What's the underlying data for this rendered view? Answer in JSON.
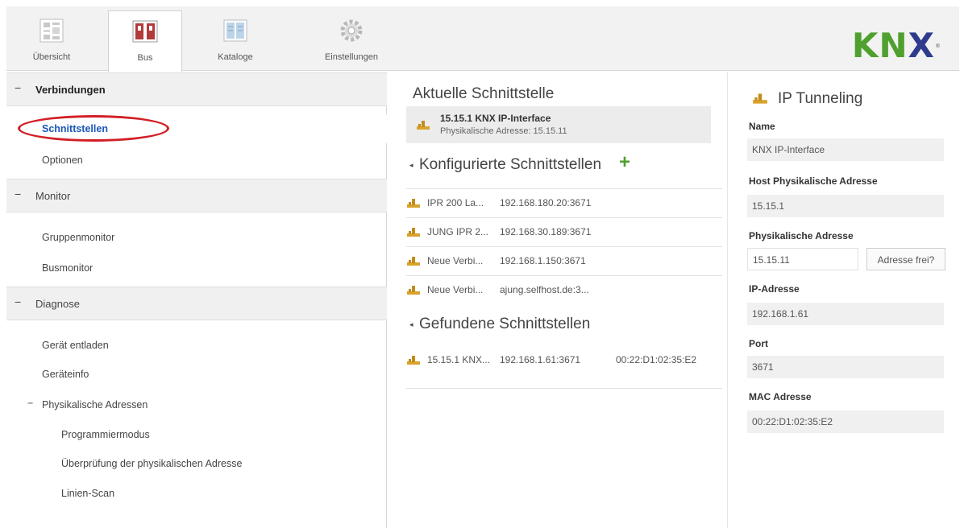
{
  "ribbon": {
    "tabs": [
      {
        "label": "Übersicht",
        "icon": "overview-icon"
      },
      {
        "label": "Bus",
        "icon": "bus-icon"
      },
      {
        "label": "Kataloge",
        "icon": "catalog-icon"
      },
      {
        "label": "Einstellungen",
        "icon": "gear-icon"
      }
    ],
    "active_tab": "Bus",
    "logo": {
      "k": "K",
      "n": "N",
      "x": "X",
      "reg": "®"
    }
  },
  "sidebar": {
    "sections": [
      {
        "label": "Verbindungen",
        "toggle": "−"
      },
      {
        "label": "Monitor",
        "toggle": "−"
      },
      {
        "label": "Diagnose",
        "toggle": "−"
      }
    ],
    "verbindungen_items": [
      "Schnittstellen",
      "Optionen"
    ],
    "monitor_items": [
      "Gruppenmonitor",
      "Busmonitor"
    ],
    "diagnose_items": [
      "Gerät entladen",
      "Geräteinfo"
    ],
    "physical_group": {
      "toggle": "−",
      "label": "Physikalische Adressen"
    },
    "physical_items": [
      "Programmiermodus",
      "Überprüfung der physikalischen Adresse",
      "Linien-Scan"
    ],
    "selected": "Schnittstellen"
  },
  "middle": {
    "current_heading": "Aktuelle Schnittstelle",
    "current": {
      "name": "15.15.1 KNX IP-Interface",
      "address": "Physikalische Adresse: 15.15.11"
    },
    "configured_heading": "Konfigurierte Schnittstellen",
    "configured_add": "+",
    "configured": [
      {
        "name": "IPR 200 La...",
        "address": "192.168.180.20:3671"
      },
      {
        "name": "JUNG IPR 2...",
        "address": "192.168.30.189:3671"
      },
      {
        "name": "Neue Verbi...",
        "address": "192.168.1.150:3671"
      },
      {
        "name": "Neue Verbi...",
        "address": "ajung.selfhost.de:3..."
      }
    ],
    "found_heading": "Gefundene Schnittstellen",
    "found": [
      {
        "name": "15.15.1 KNX...",
        "address": "192.168.1.61:3671",
        "mac": "00:22:D1:02:35:E2"
      }
    ],
    "collapse_glyph": "◂"
  },
  "details": {
    "title": "IP Tunneling",
    "fields": {
      "name_label": "Name",
      "name_value": "KNX IP-Interface",
      "host_label": "Host Physikalische Adresse",
      "host_value": "15.15.1",
      "phys_label": "Physikalische Adresse",
      "phys_value": "15.15.11",
      "phys_button": "Adresse frei?",
      "ip_label": "IP-Adresse",
      "ip_value": "192.168.1.61",
      "port_label": "Port",
      "port_value": "3671",
      "mac_label": "MAC Adresse",
      "mac_value": "00:22:D1:02:35:E2"
    }
  },
  "colors": {
    "knx_green": "#4fa02f",
    "knx_blue": "#2f3b8c",
    "selection": "#1a56b8",
    "highlight_ring": "#d21f26"
  }
}
